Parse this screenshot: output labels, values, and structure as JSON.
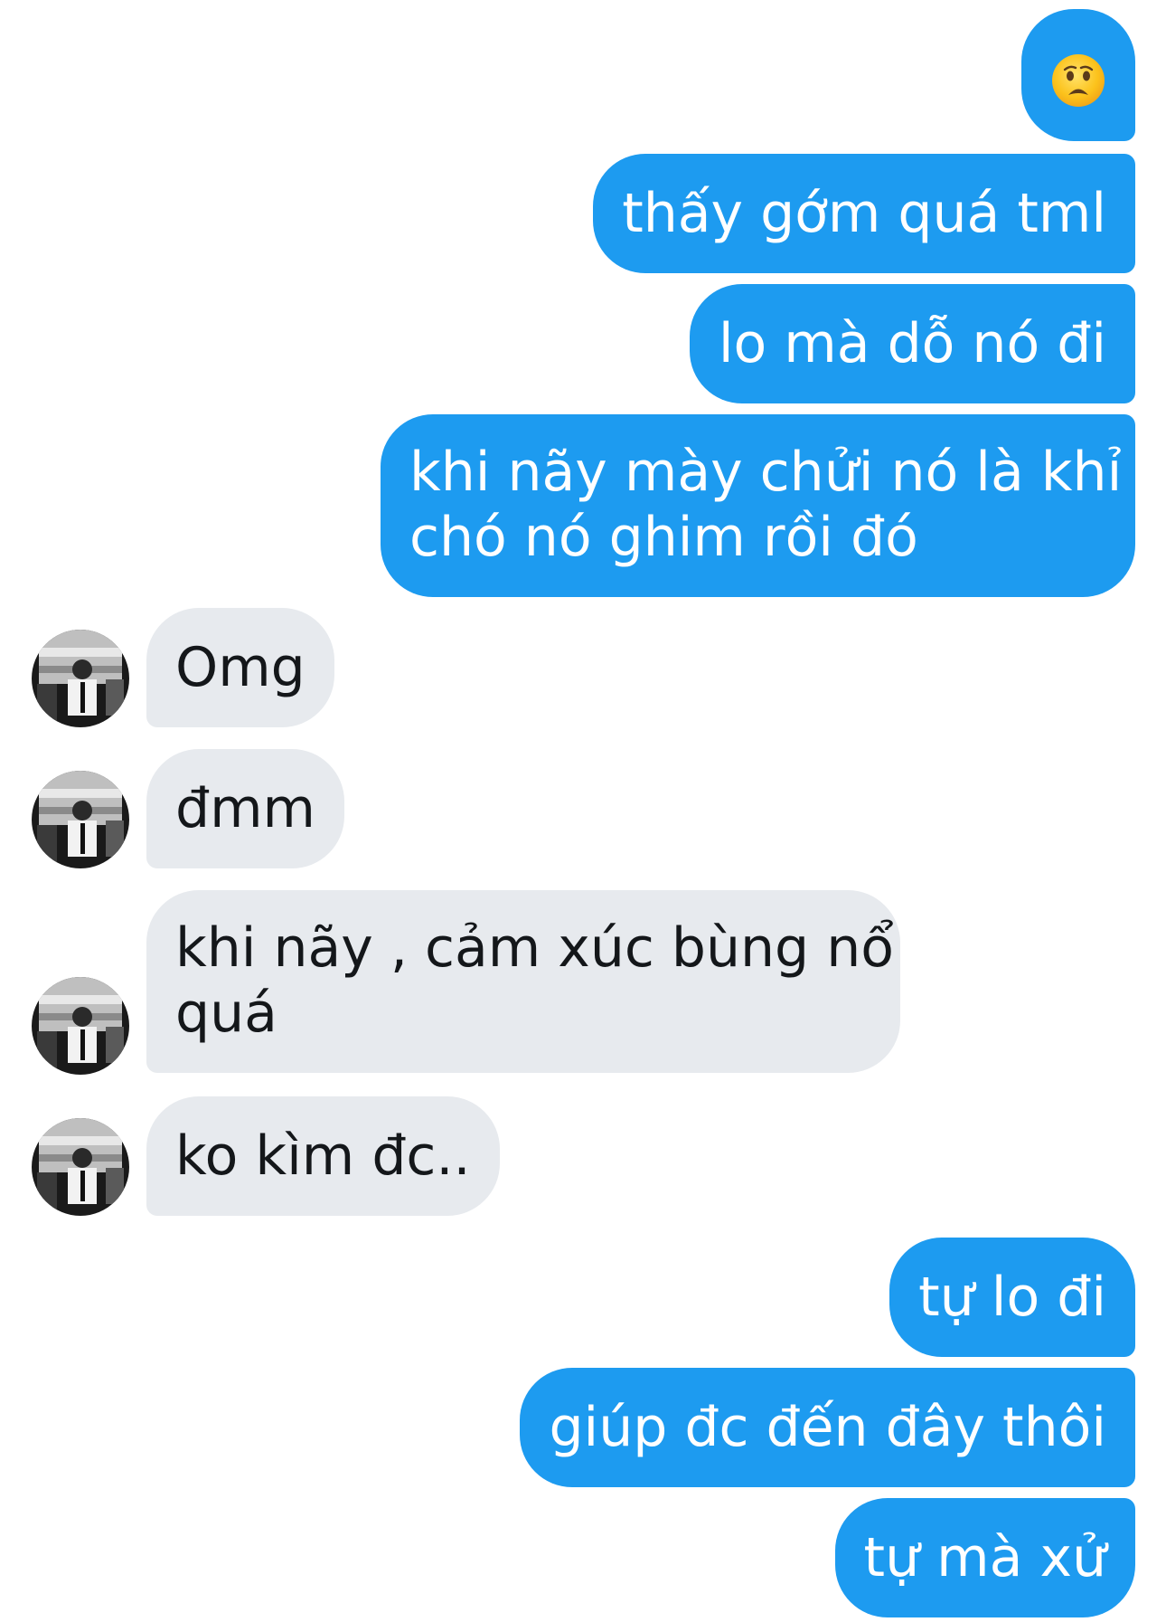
{
  "conversation": {
    "messages": [
      {
        "side": "sent",
        "text": "😦",
        "emoji": "frowning-face-emoji"
      },
      {
        "side": "sent",
        "text": "thấy gớm quá tml"
      },
      {
        "side": "sent",
        "text": "lo mà dỗ nó đi"
      },
      {
        "side": "sent",
        "lines": [
          "khi nãy mày chửi nó là khỉ",
          "chó nó ghim rồi đó"
        ]
      },
      {
        "side": "received",
        "text": "Omg"
      },
      {
        "side": "received",
        "text": "đmm"
      },
      {
        "side": "received",
        "lines": [
          "khi nãy , cảm xúc bùng nổ",
          "quá"
        ]
      },
      {
        "side": "received",
        "text": "ko kìm đc.."
      },
      {
        "side": "sent",
        "text": "tự lo đi"
      },
      {
        "side": "sent",
        "text": "giúp đc đến đây thôi"
      },
      {
        "side": "sent",
        "text": "tự mà xử"
      }
    ]
  },
  "colors": {
    "sent_bubble": "#1d9bf0",
    "sent_text": "#ffffff",
    "received_bubble": "#e7eaee",
    "received_text": "#14171a",
    "background": "#ffffff"
  },
  "icons": {
    "avatar": "contact-avatar-photo",
    "emoji": "frowning-face-emoji"
  }
}
